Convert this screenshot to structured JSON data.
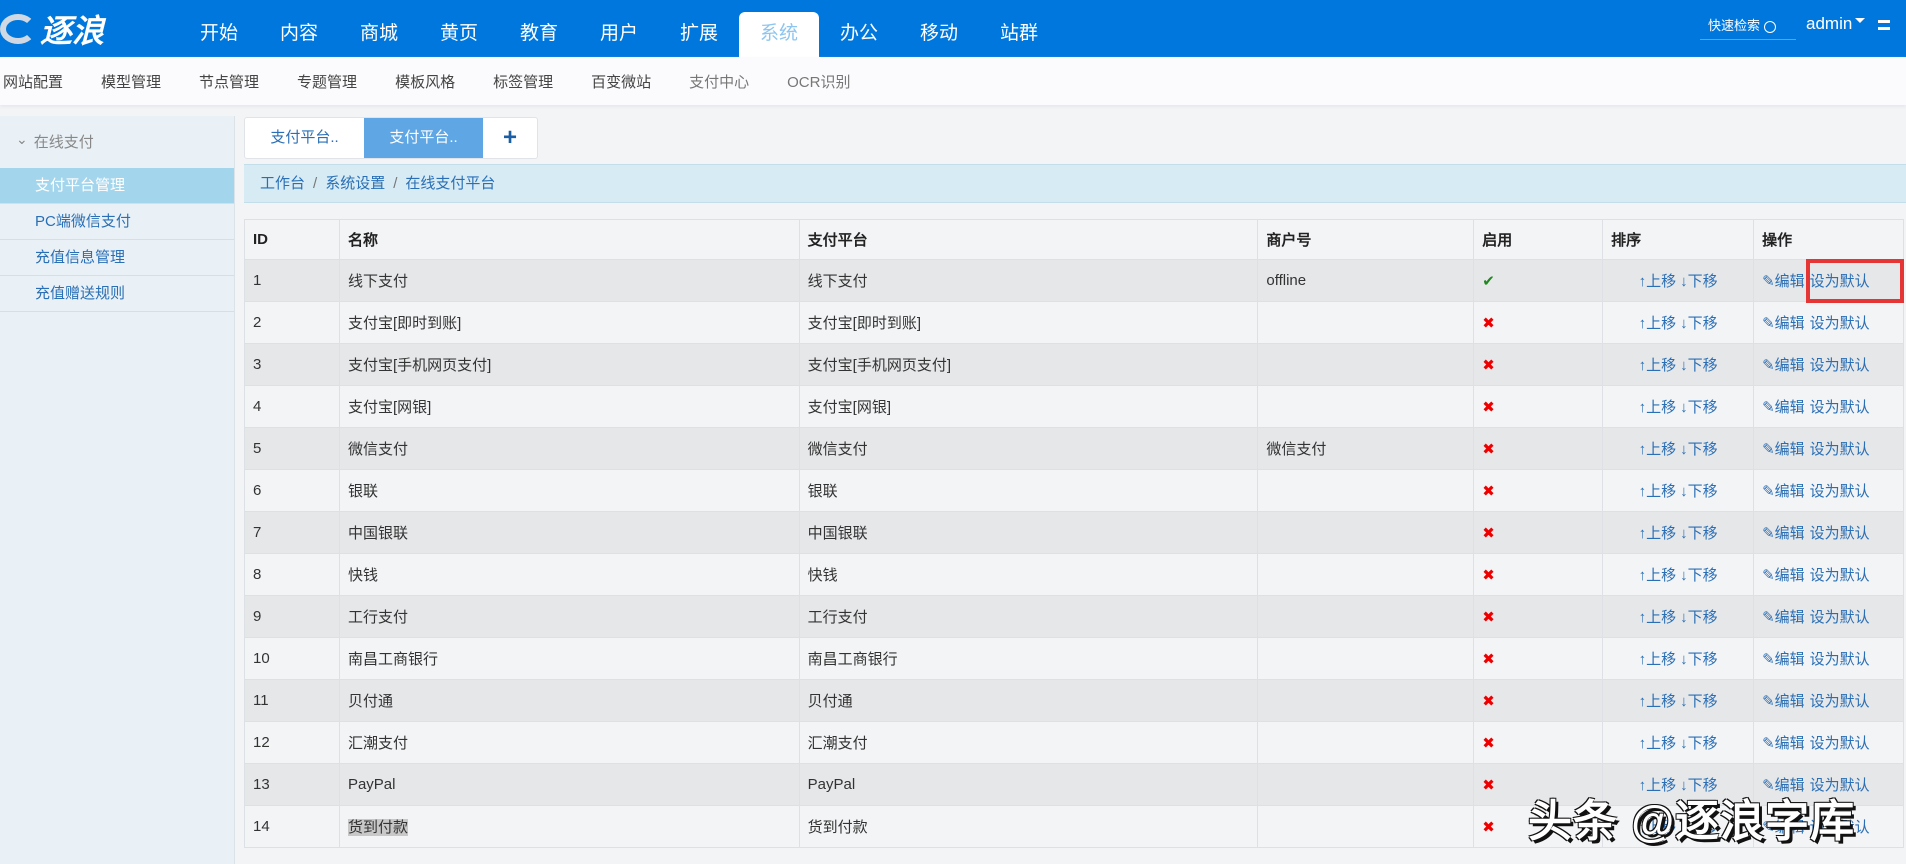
{
  "header": {
    "logo": "逐浪",
    "nav": [
      "开始",
      "内容",
      "商城",
      "黄页",
      "教育",
      "用户",
      "扩展",
      "系统",
      "办公",
      "移动",
      "站群"
    ],
    "active_nav": "系统",
    "search_label": "快速检索",
    "user": "admin"
  },
  "subnav": [
    "网站配置",
    "模型管理",
    "节点管理",
    "专题管理",
    "模板风格",
    "标签管理",
    "百变微站",
    "支付中心",
    "OCR识别"
  ],
  "sidebar": {
    "group": "在线支付",
    "items": [
      "支付平台管理",
      "PC端微信支付",
      "充值信息管理",
      "充值赠送规则"
    ]
  },
  "tabs": [
    "支付平台..",
    "支付平台..",
    "+"
  ],
  "breadcrumb": [
    "工作台",
    "系统设置",
    "在线支付平台"
  ],
  "table": {
    "headers": [
      "ID",
      "名称",
      "支付平台",
      "商户号",
      "启用",
      "排序",
      "操作"
    ],
    "rows": [
      [
        "1",
        "线下支付",
        "线下支付",
        "offline",
        true
      ],
      [
        "2",
        "支付宝[即时到账]",
        "支付宝[即时到账]",
        "",
        false
      ],
      [
        "3",
        "支付宝[手机网页支付]",
        "支付宝[手机网页支付]",
        "",
        false
      ],
      [
        "4",
        "支付宝[网银]",
        "支付宝[网银]",
        "",
        false
      ],
      [
        "5",
        "微信支付",
        "微信支付",
        "微信支付",
        false
      ],
      [
        "6",
        "银联",
        "银联",
        "",
        false
      ],
      [
        "7",
        "中国银联",
        "中国银联",
        "",
        false
      ],
      [
        "8",
        "快钱",
        "快钱",
        "",
        false
      ],
      [
        "9",
        "工行支付",
        "工行支付",
        "",
        false
      ],
      [
        "10",
        "南昌工商银行",
        "南昌工商银行",
        "",
        false
      ],
      [
        "11",
        "贝付通",
        "贝付通",
        "",
        false
      ],
      [
        "12",
        "汇潮支付",
        "汇潮支付",
        "",
        false
      ],
      [
        "13",
        "PayPal",
        "PayPal",
        "",
        false
      ],
      [
        "14",
        "货到付款",
        "货到付款",
        "",
        false
      ]
    ],
    "up": "上移",
    "down": "下移",
    "edit": "编辑",
    "set_default": "设为默认",
    "enabled_mark": "✔",
    "disabled_mark": "✖"
  },
  "watermark": "头条 @逐浪字库"
}
